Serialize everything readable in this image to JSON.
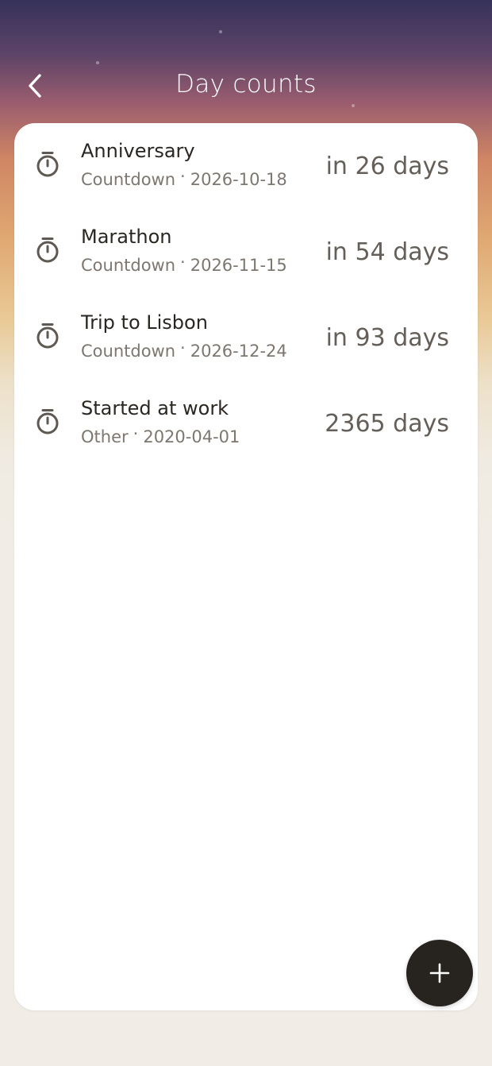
{
  "header": {
    "title": "Day counts",
    "back_icon": "chevron-left-icon"
  },
  "items": [
    {
      "name": "Anniversary",
      "category": "Countdown",
      "separator": "·",
      "date": "2026-10-18",
      "count": "in 26 days",
      "icon": "stopwatch-icon"
    },
    {
      "name": "Marathon",
      "category": "Countdown",
      "separator": "·",
      "date": "2026-11-15",
      "count": "in 54 days",
      "icon": "stopwatch-icon"
    },
    {
      "name": "Trip to Lisbon",
      "category": "Countdown",
      "separator": "·",
      "date": "2026-12-24",
      "count": "in 93 days",
      "icon": "stopwatch-icon"
    },
    {
      "name": "Started at work",
      "category": "Other",
      "separator": "·",
      "date": "2020-04-01",
      "count": "2365 days",
      "icon": "stopwatch-icon"
    }
  ],
  "fab": {
    "icon": "plus-icon",
    "color": "#27231f"
  },
  "colors": {
    "gradient_top": "#36325a",
    "gradient_mid": "#cf8664",
    "gradient_low": "#e9c995",
    "background": "#f1ede6",
    "card": "#ffffff",
    "count_text": "#655f59"
  }
}
